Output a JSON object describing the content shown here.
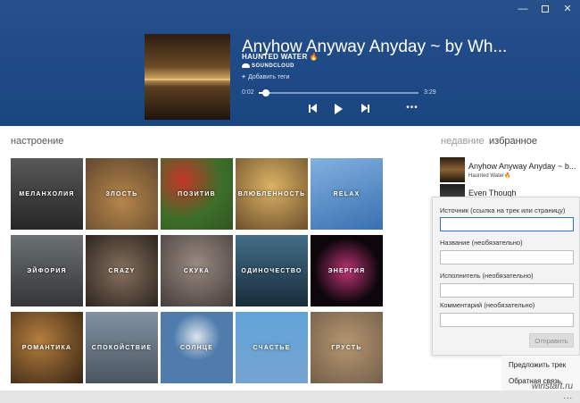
{
  "window": {
    "minimize": "—",
    "close": "✕"
  },
  "player": {
    "title": "Anyhow Anyway Anyday ~ by Wh...",
    "artist": "HAUNTED WATER",
    "source": "SOUNDCLOUD",
    "add_tags": "Добавить теги",
    "time_current": "0:02",
    "time_total": "3:29",
    "progress": 0.02,
    "more": "•••"
  },
  "mood": {
    "title": "настроение",
    "tiles": [
      {
        "label": "меланхолия",
        "bg": "#3b3b3b"
      },
      {
        "label": "злость",
        "bg": "#7a5a3a"
      },
      {
        "label": "позитив",
        "bg": "#3d6b2a"
      },
      {
        "label": "влюбленность",
        "bg": "#8a6a3a"
      },
      {
        "label": "relax",
        "bg": "#3f7ab8"
      },
      {
        "label": "эйфория",
        "bg": "#555b5e"
      },
      {
        "label": "crazy",
        "bg": "#5a4a3e"
      },
      {
        "label": "скука",
        "bg": "#6a5e58"
      },
      {
        "label": "одиночество",
        "bg": "#2e5266"
      },
      {
        "label": "энергия",
        "bg": "#2a1626"
      },
      {
        "label": "романтика",
        "bg": "#6b4a2a"
      },
      {
        "label": "спокойствие",
        "bg": "#6d7a86"
      },
      {
        "label": "солнце",
        "bg": "#4f7aa6"
      },
      {
        "label": "счастье",
        "bg": "#4a8ac4"
      },
      {
        "label": "грусть",
        "bg": "#7d6a55"
      }
    ]
  },
  "recent": {
    "tab_recent": "недавние",
    "tab_favorites": "избранное",
    "items": [
      {
        "title": "Anyhow Anyway Anyday ~ b...",
        "sub": "Haunted Water"
      },
      {
        "title": "Even Though",
        "sub": ""
      }
    ]
  },
  "suggest": {
    "source_label": "Источник (ссылка на трек или страницу)",
    "source_value": "",
    "name_label": "Название (необязательно)",
    "name_value": "",
    "artist_label": "Исполнитель (необязательно)",
    "artist_value": "",
    "comment_label": "Комментарий (необязательно)",
    "comment_value": "",
    "submit": "Отправить"
  },
  "menu": {
    "suggest_track": "Предложить трек",
    "feedback": "Обратная связь"
  },
  "bottom": {
    "more": "..."
  },
  "watermark": "winstart.ru"
}
